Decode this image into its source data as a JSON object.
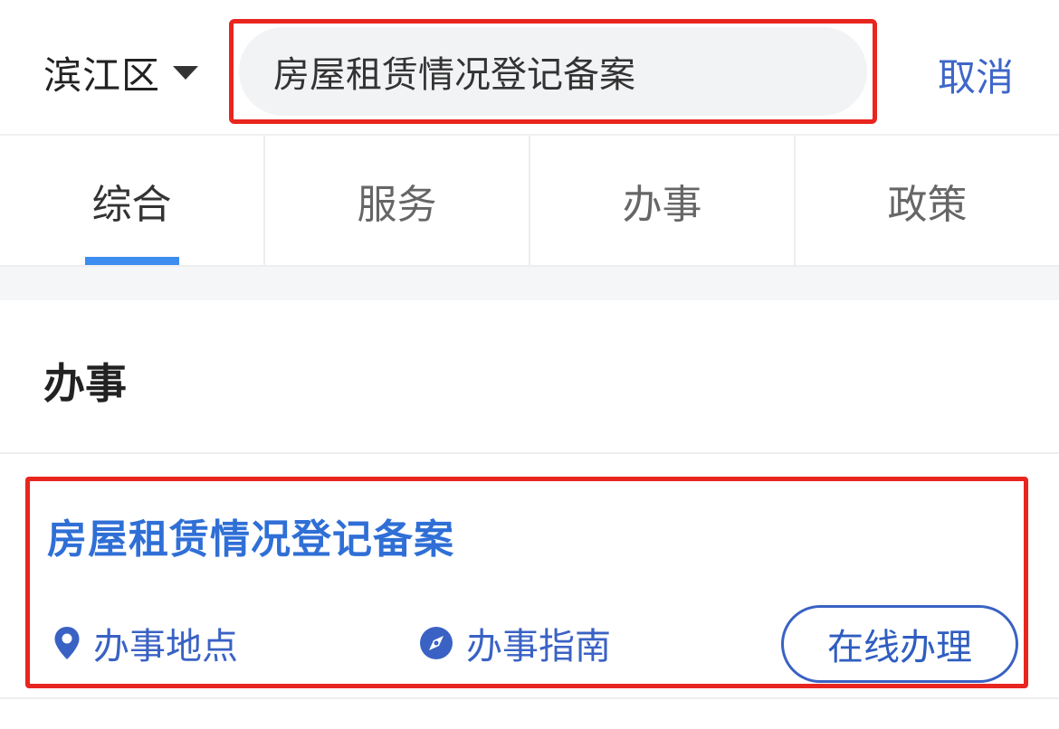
{
  "header": {
    "region": "滨江区",
    "search": {
      "value": "房屋租赁情况登记备案",
      "placeholder": ""
    },
    "cancel_label": "取消"
  },
  "tabs": [
    {
      "label": "综合",
      "active": true
    },
    {
      "label": "服务",
      "active": false
    },
    {
      "label": "办事",
      "active": false
    },
    {
      "label": "政策",
      "active": false
    }
  ],
  "section": {
    "title": "办事"
  },
  "result": {
    "title": "房屋租赁情况登记备案",
    "location_label": "办事地点",
    "guide_label": "办事指南",
    "online_label": "在线办理"
  },
  "colors": {
    "accent_blue": "#3d8cf0",
    "link_blue": "#3a62c4",
    "highlight_red": "#e8261f"
  },
  "icons": {
    "region_caret": "caret-down-icon",
    "location": "location-pin-icon",
    "guide": "compass-icon"
  }
}
